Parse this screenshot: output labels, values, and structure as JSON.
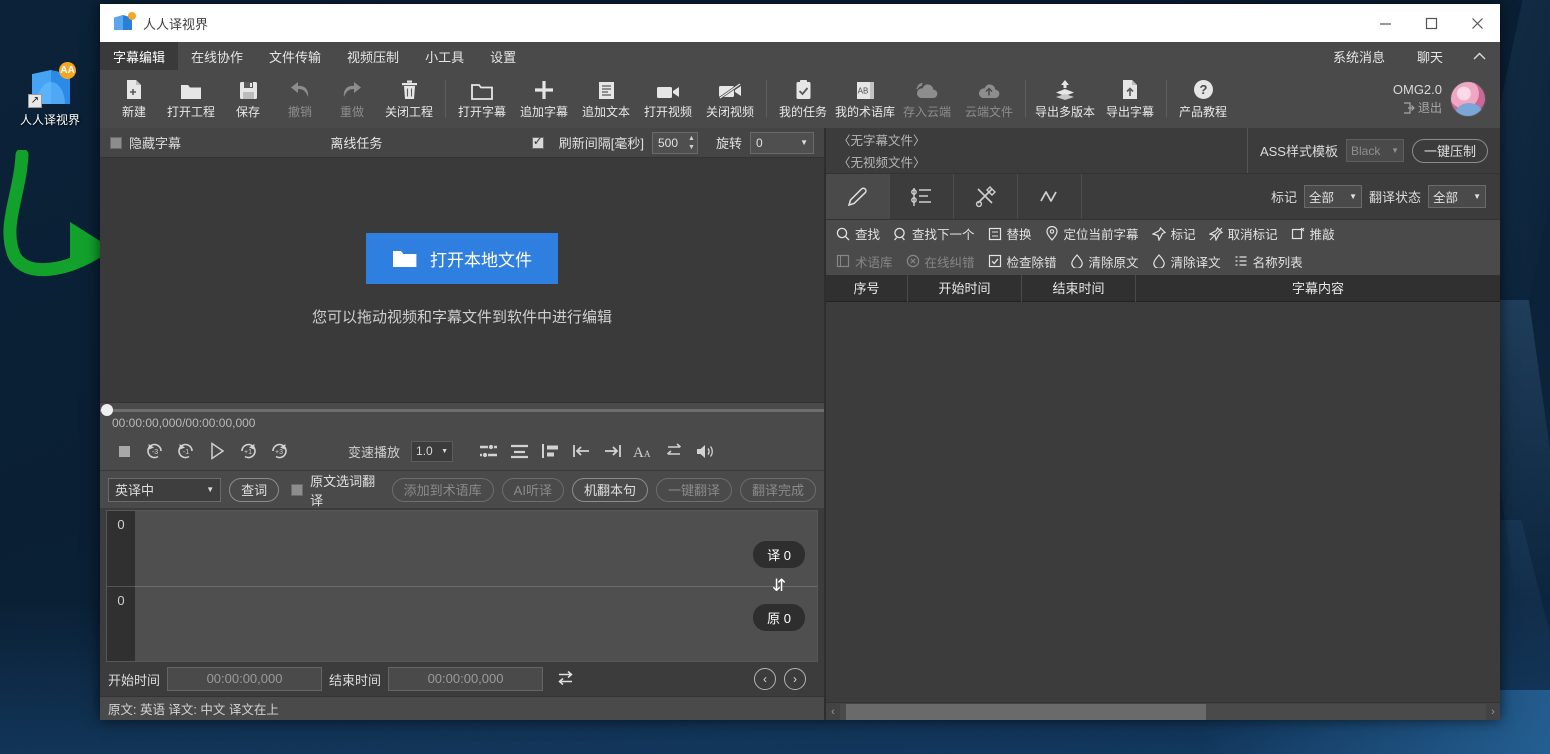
{
  "desktop": {
    "icon_label": "人人译视界",
    "icon_name": "renren-yishijie-shortcut",
    "badge": "AA"
  },
  "window": {
    "title": "人人译视界",
    "controls": {
      "minimize": "—",
      "maximize": "❐",
      "close": "✕"
    }
  },
  "menubar": {
    "items": [
      {
        "label": "字幕编辑",
        "active": true
      },
      {
        "label": "在线协作",
        "active": false
      },
      {
        "label": "文件传输",
        "active": false
      },
      {
        "label": "视频压制",
        "active": false
      },
      {
        "label": "小工具",
        "active": false
      },
      {
        "label": "设置",
        "active": false
      }
    ],
    "right_items": [
      {
        "label": "系统消息"
      },
      {
        "label": "聊天"
      }
    ],
    "collapse_icon": "chevron-up-icon"
  },
  "toolbar": {
    "groups": [
      [
        {
          "label": "新建",
          "icon": "new-file-icon",
          "disabled": false
        },
        {
          "label": "打开工程",
          "icon": "open-folder-icon",
          "disabled": false
        },
        {
          "label": "保存",
          "icon": "save-disk-icon",
          "disabled": false
        },
        {
          "label": "撤销",
          "icon": "undo-arrow-icon",
          "disabled": true
        },
        {
          "label": "重做",
          "icon": "redo-arrow-icon",
          "disabled": true
        },
        {
          "label": "关闭工程",
          "icon": "trash-icon",
          "disabled": false
        }
      ],
      [
        {
          "label": "打开字幕",
          "icon": "open-subtitle-folder-icon",
          "disabled": false
        },
        {
          "label": "追加字幕",
          "icon": "plus-icon",
          "disabled": false
        },
        {
          "label": "追加文本",
          "icon": "text-document-icon",
          "disabled": false
        },
        {
          "label": "打开视频",
          "icon": "video-camera-icon",
          "disabled": false
        },
        {
          "label": "关闭视频",
          "icon": "video-camera-off-icon",
          "disabled": false
        }
      ],
      [
        {
          "label": "我的任务",
          "icon": "clipboard-check-icon",
          "disabled": false
        },
        {
          "label": "我的术语库",
          "icon": "ab-glossary-icon",
          "disabled": false
        },
        {
          "label": "存入云端",
          "icon": "cloud-sync-icon",
          "disabled": true
        },
        {
          "label": "云端文件",
          "icon": "cloud-upload-icon",
          "disabled": true
        }
      ],
      [
        {
          "label": "导出多版本",
          "icon": "export-layers-icon",
          "disabled": false
        },
        {
          "label": "导出字幕",
          "icon": "export-file-icon",
          "disabled": false
        }
      ],
      [
        {
          "label": "产品教程",
          "icon": "help-question-icon",
          "disabled": false
        }
      ]
    ],
    "account": {
      "name": "OMG2.0",
      "logout": "退出",
      "logout_icon": "logout-icon",
      "avatar": "user-avatar"
    }
  },
  "left_panel": {
    "options": {
      "hide_subtitle_label": "隐藏字幕",
      "hide_subtitle_checked": false,
      "offline_task_label": "离线任务",
      "refresh_label": "刷新间隔[毫秒]",
      "refresh_checked": true,
      "refresh_value": "500",
      "rotate_label": "旋转",
      "rotate_value": "0"
    },
    "video": {
      "open_button": "打开本地文件",
      "open_button_icon": "folder-open-icon",
      "hint": "您可以拖动视频和字幕文件到软件中进行编辑"
    },
    "player": {
      "timecode": "00:00:00,000/00:00:00,000",
      "buttons": [
        {
          "icon": "stop-icon",
          "label": "停止"
        },
        {
          "icon": "back-3s-icon",
          "label": "-3"
        },
        {
          "icon": "back-1s-icon",
          "label": "-1"
        },
        {
          "icon": "play-icon",
          "label": "播放"
        },
        {
          "icon": "forward-1s-icon",
          "label": "+1"
        },
        {
          "icon": "forward-3s-icon",
          "label": "+3"
        }
      ],
      "speed_label": "变速播放",
      "speed_value": "1.0",
      "right_buttons": [
        {
          "icon": "align-both-icon"
        },
        {
          "icon": "align-bottom-icon"
        },
        {
          "icon": "align-left-icon"
        },
        {
          "icon": "set-start-icon"
        },
        {
          "icon": "set-end-icon"
        },
        {
          "icon": "font-size-icon"
        },
        {
          "icon": "swap-lines-icon"
        },
        {
          "icon": "volume-icon"
        }
      ]
    },
    "translate_bar": {
      "lang_value": "英译中",
      "lookup_button": "查词",
      "select_translate_label": "原文选词翻译",
      "select_translate_checked": false,
      "buttons": [
        {
          "label": "添加到术语库",
          "disabled": true
        },
        {
          "label": "AI听译",
          "disabled": true
        },
        {
          "label": "机翻本句",
          "disabled": false
        },
        {
          "label": "一键翻译",
          "disabled": true
        },
        {
          "label": "翻译完成",
          "disabled": true
        }
      ]
    },
    "editor": {
      "row1_number": "0",
      "row2_number": "0",
      "translated_tag": "译 0",
      "original_tag": "原 0",
      "swap_icon": "swap-vertical-icon"
    },
    "time_row": {
      "start_label": "开始时间",
      "start_value": "00:00:00,000",
      "end_label": "结束时间",
      "end_value": "00:00:00,000",
      "swap_icon": "swap-horizontal-icon",
      "prev_icon": "prev-chevron-icon",
      "next_icon": "next-chevron-icon"
    },
    "status": "原文: 英语  译文: 中文   译文在上"
  },
  "right_panel": {
    "files": {
      "subtitle_file": "〈无字幕文件〉",
      "video_file": "〈无视频文件〉"
    },
    "ass": {
      "label": "ASS样式模板",
      "value": "Black",
      "compress_button": "一键压制"
    },
    "tabs": [
      {
        "icon": "pencil-edit-icon",
        "active": true
      },
      {
        "icon": "list-settings-icon",
        "active": false
      },
      {
        "icon": "tools-scissors-icon",
        "active": false
      },
      {
        "icon": "waveform-icon",
        "active": false
      }
    ],
    "filters": [
      {
        "label": "标记",
        "value": "全部"
      },
      {
        "label": "翻译状态",
        "value": "全部"
      }
    ],
    "actions_row1": [
      {
        "label": "查找",
        "icon": "search-icon",
        "disabled": false
      },
      {
        "label": "查找下一个",
        "icon": "search-next-icon",
        "disabled": false
      },
      {
        "label": "替换",
        "icon": "replace-icon",
        "disabled": false
      },
      {
        "label": "定位当前字幕",
        "icon": "locate-pin-icon",
        "disabled": false
      },
      {
        "label": "标记",
        "icon": "pin-icon",
        "disabled": false
      },
      {
        "label": "取消标记",
        "icon": "unpin-icon",
        "disabled": false
      },
      {
        "label": "推敲",
        "icon": "polish-icon",
        "disabled": false
      }
    ],
    "actions_row2": [
      {
        "label": "术语库",
        "icon": "glossary-book-icon",
        "disabled": true
      },
      {
        "label": "在线纠错",
        "icon": "online-correct-icon",
        "disabled": true
      },
      {
        "label": "检查除错",
        "icon": "check-errors-icon",
        "disabled": false
      },
      {
        "label": "清除原文",
        "icon": "clear-original-icon",
        "disabled": false
      },
      {
        "label": "清除译文",
        "icon": "clear-translation-icon",
        "disabled": false
      },
      {
        "label": "名称列表",
        "icon": "name-list-icon",
        "disabled": false
      }
    ],
    "table": {
      "columns": [
        "序号",
        "开始时间",
        "结束时间",
        "字幕内容"
      ],
      "rows": []
    },
    "scroll": {
      "left_icon": "scroll-left-icon",
      "right_icon": "scroll-right-icon"
    }
  }
}
